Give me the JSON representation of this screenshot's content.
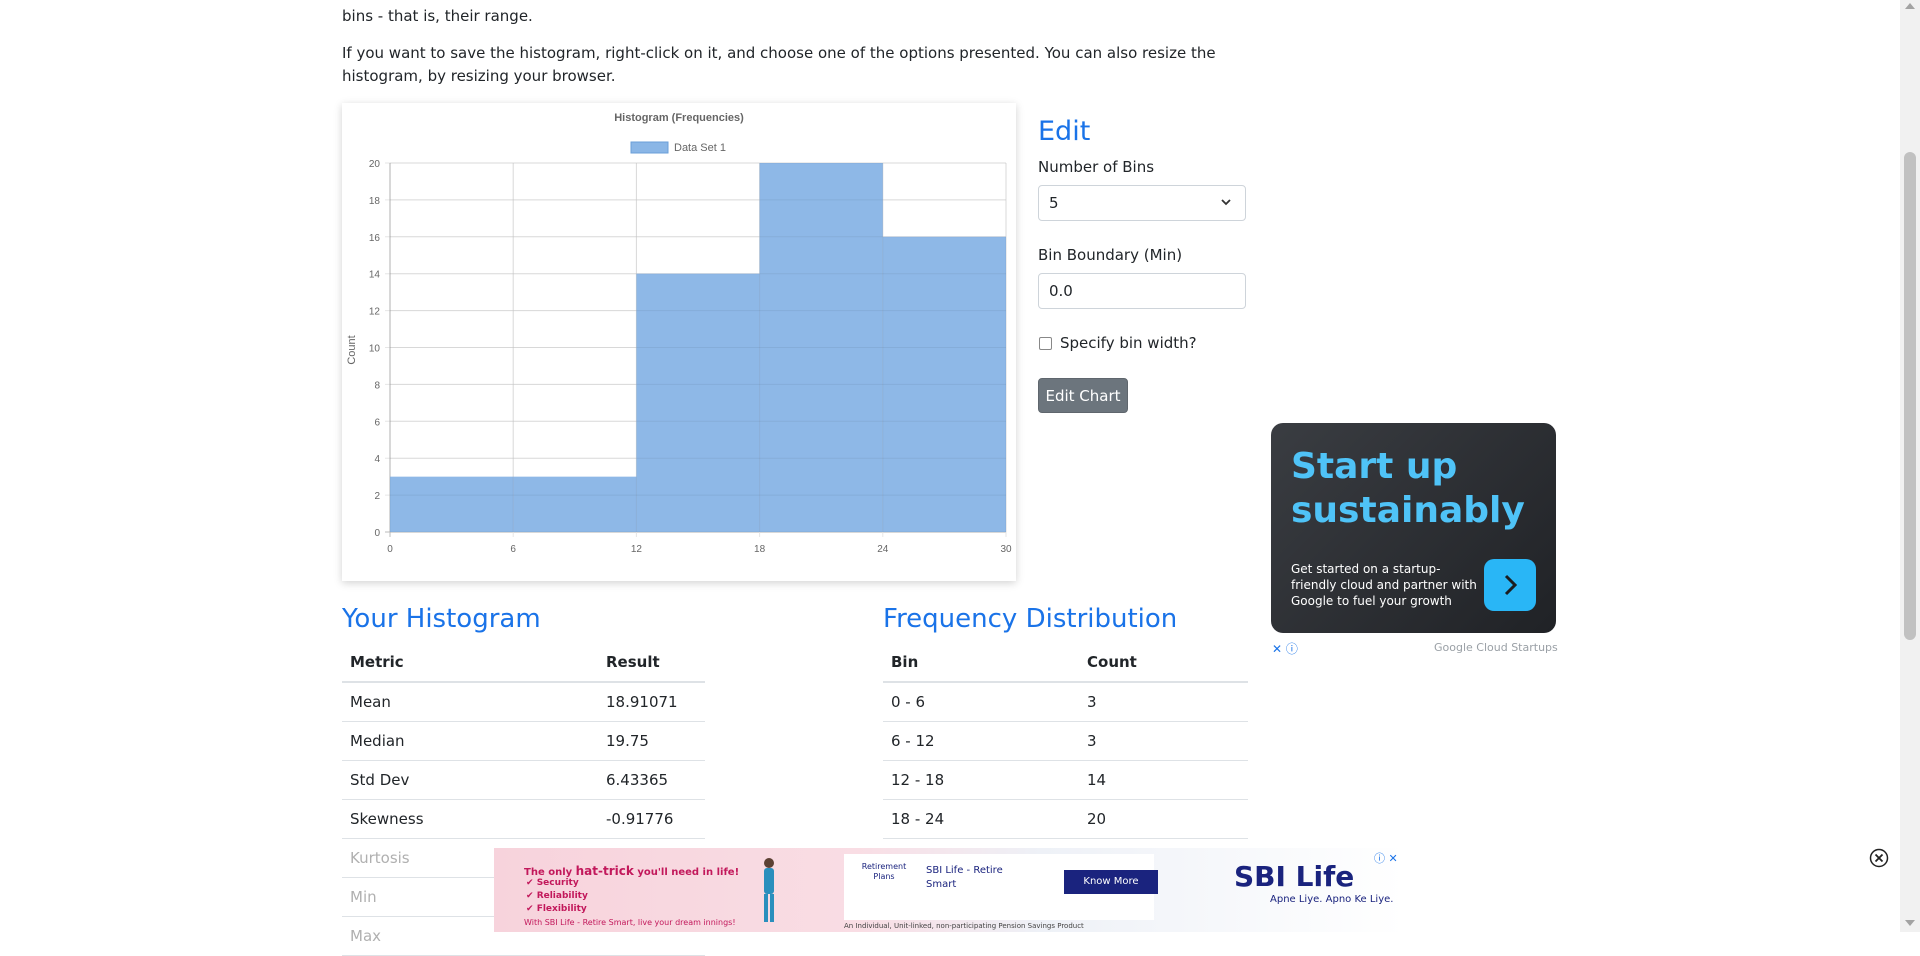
{
  "intro": {
    "line_top": "bins - that is, their range.",
    "para2": "If you want to save the histogram, right-click on it, and choose one of the options presented. You can also resize the histogram, by resizing your browser."
  },
  "chart_data": {
    "type": "bar",
    "title": "Histogram (Frequencies)",
    "legend": [
      "Data Set 1"
    ],
    "legend_position": "top",
    "xlabel": "",
    "ylabel": "Count",
    "x_ticks": [
      "0",
      "6",
      "12",
      "18",
      "24",
      "30"
    ],
    "y_ticks": [
      "0",
      "2",
      "4",
      "6",
      "8",
      "10",
      "12",
      "14",
      "16",
      "18",
      "20"
    ],
    "bins": [
      [
        0,
        6
      ],
      [
        6,
        12
      ],
      [
        12,
        18
      ],
      [
        18,
        24
      ],
      [
        24,
        30
      ]
    ],
    "series": [
      {
        "name": "Data Set 1",
        "values": [
          3,
          3,
          14,
          20,
          16
        ]
      }
    ],
    "xlim": [
      0,
      30
    ],
    "ylim": [
      0,
      20
    ],
    "grid": true,
    "color": "#8ab6e6"
  },
  "edit": {
    "title": "Edit",
    "bins_label": "Number of Bins",
    "bins_value": "5",
    "boundary_label": "Bin Boundary (Min)",
    "boundary_value": "0.0",
    "width_checkbox_label": "Specify bin width?",
    "width_checked": false,
    "button": "Edit Chart"
  },
  "your_histogram": {
    "title": "Your Histogram",
    "headers": [
      "Metric",
      "Result"
    ],
    "rows": [
      [
        "Mean",
        "18.91071"
      ],
      [
        "Median",
        "19.75"
      ],
      [
        "Std Dev",
        "6.43365"
      ],
      [
        "Skewness",
        "-0.91776"
      ],
      [
        "Kurtosis",
        ""
      ],
      [
        "Min",
        ""
      ],
      [
        "Max",
        ""
      ]
    ]
  },
  "frequency_distribution": {
    "title": "Frequency Distribution",
    "headers": [
      "Bin",
      "Count"
    ],
    "rows": [
      [
        "0 - 6",
        "3"
      ],
      [
        "6 - 12",
        "3"
      ],
      [
        "12 - 18",
        "14"
      ],
      [
        "18 - 24",
        "20"
      ]
    ]
  },
  "ad_right": {
    "headline": "Start up sustainably",
    "body": "Get started on a startup-friendly cloud and partner with Google to fuel your growth",
    "brand": "Google Cloud Startups",
    "close": "✕ ⓘ"
  },
  "ad_bottom": {
    "tagline_pre": "The only ",
    "tagline_bold": "hat-trick",
    "tagline_post": " you'll need in life!",
    "checks": [
      "Security",
      "Reliability",
      "Flexibility"
    ],
    "footer": "With SBI Life - Retire Smart, live your dream innings!",
    "retirement": "Retirement Plans",
    "product_name": "SBI Life - Retire Smart",
    "cta": "Know More",
    "logo": "SBI Life",
    "logo_sub": "Apne Liye. Apno Ke Liye.",
    "disclaimer": "An Individual, Unit-linked, non-participating Pension Savings Product"
  }
}
